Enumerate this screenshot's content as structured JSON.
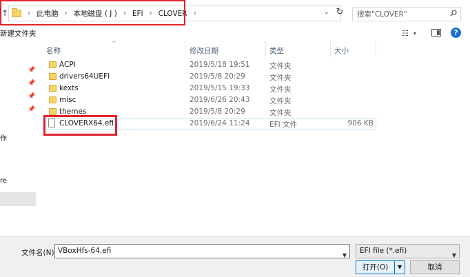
{
  "addressbar": {
    "crumbs": [
      "此电脑",
      "本地磁盘 ( J )",
      "EFI",
      "CLOVER"
    ],
    "search_placeholder": "搜索\"CLOVER\""
  },
  "toolbar": {
    "new_folder_label": "新建文件夹"
  },
  "nav": {
    "fragments": [
      "作",
      "re"
    ]
  },
  "columns": {
    "name": "名称",
    "date": "修改日期",
    "type": "类型",
    "size": "大小"
  },
  "files": [
    {
      "name": "ACPI",
      "date": "2019/5/18 19:51",
      "type": "文件夹",
      "size": "",
      "kind": "folder"
    },
    {
      "name": "drivers64UEFI",
      "date": "2019/5/8 20:29",
      "type": "文件夹",
      "size": "",
      "kind": "folder"
    },
    {
      "name": "kexts",
      "date": "2019/5/15 19:33",
      "type": "文件夹",
      "size": "",
      "kind": "folder"
    },
    {
      "name": "misc",
      "date": "2019/6/26 20:43",
      "type": "文件夹",
      "size": "",
      "kind": "folder"
    },
    {
      "name": "themes",
      "date": "2019/5/8 20:29",
      "type": "文件夹",
      "size": "",
      "kind": "folder"
    },
    {
      "name": "CLOVERX64.efi",
      "date": "2019/6/24 11:24",
      "type": "EFI 文件",
      "size": "906 KB",
      "kind": "file"
    }
  ],
  "bottom": {
    "filename_label": "文件名(N):",
    "filename_value": "VBoxHfs-64.efi",
    "filetype_value": "EFI file (*.efi)",
    "open_label": "打开(O)",
    "cancel_label": "取消"
  },
  "colors": {
    "highlight_red": "#e0232e",
    "folder_yellow": "#f7d46a",
    "accent_blue": "#0078d7"
  }
}
